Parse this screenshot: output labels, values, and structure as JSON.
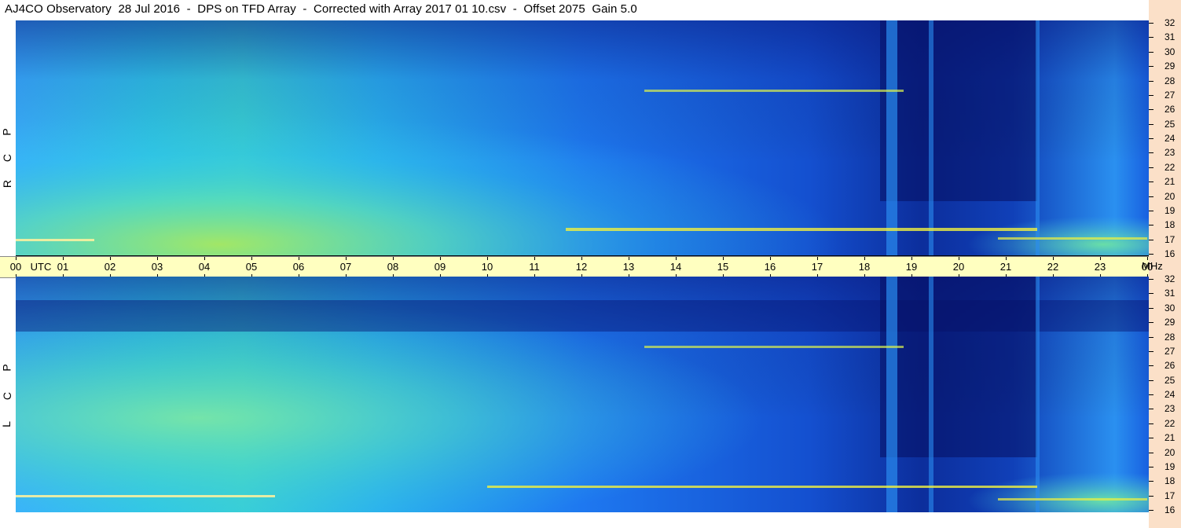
{
  "title": "AJ4CO Observatory  28 Jul 2016  -  DPS on TFD Array  -  Corrected with Array 2017 01 10.csv  -  Offset 2075  Gain 5.0",
  "panels": {
    "top_label": [
      "R",
      "C",
      "P"
    ],
    "bottom_label": [
      "L",
      "C",
      "P"
    ]
  },
  "utc_axis": {
    "labels": [
      "00",
      "01",
      "02",
      "03",
      "04",
      "05",
      "06",
      "07",
      "08",
      "09",
      "10",
      "11",
      "12",
      "13",
      "14",
      "15",
      "16",
      "17",
      "18",
      "19",
      "20",
      "21",
      "22",
      "23",
      "00"
    ],
    "utc_word": "UTC",
    "unit": "MHz"
  },
  "freq_axis": {
    "labels": [
      "32",
      "31",
      "30",
      "29",
      "28",
      "27",
      "26",
      "25",
      "24",
      "23",
      "22",
      "21",
      "20",
      "19",
      "18",
      "17",
      "16"
    ]
  },
  "colors": {
    "deep": "#0a1a8a",
    "mid": "#1a5de8",
    "bright": "#2aa0ff",
    "cyan": "#40d8d0",
    "green": "#90e870",
    "yellow": "#f0f040",
    "utc_bar": "#ffffc0",
    "scale_bg": "#fbe0c8"
  },
  "chart_data": {
    "type": "heatmap",
    "title": "AJ4CO Observatory  28 Jul 2016  -  DPS on TFD Array  -  Corrected with Array 2017 01 10.csv  -  Offset 2075  Gain 5.0",
    "xlabel": "UTC",
    "ylabel": "MHz",
    "x_range": [
      0,
      24
    ],
    "y_range": [
      16,
      32
    ],
    "series": [
      {
        "name": "R C P",
        "values": []
      },
      {
        "name": "L C P",
        "values": []
      }
    ]
  }
}
